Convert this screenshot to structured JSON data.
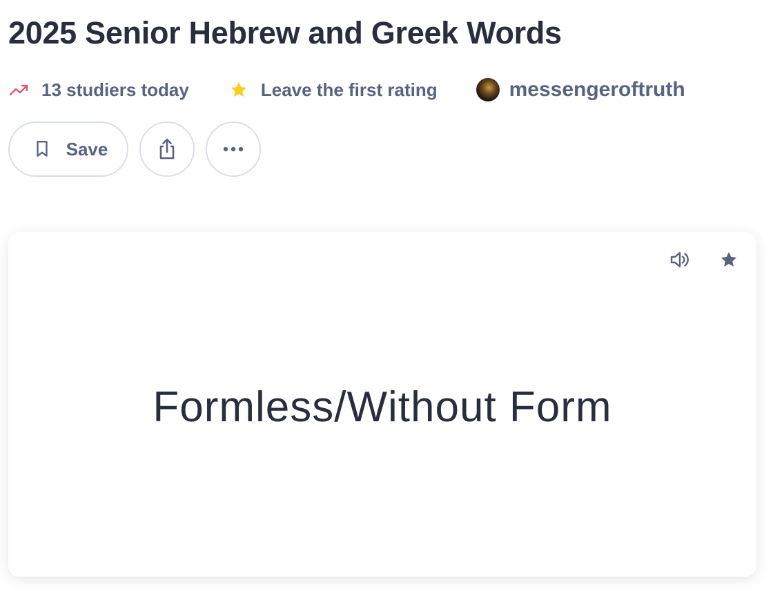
{
  "set": {
    "title": "2025 Senior Hebrew and Greek Words"
  },
  "meta": {
    "studiers": "13 studiers today",
    "studiers_icon": "trending-up-icon",
    "rating": "Leave the first rating",
    "rating_icon": "star-icon",
    "author": "messengeroftruth"
  },
  "actions": {
    "save_label": "Save",
    "save_icon": "bookmark-icon",
    "share_icon": "share-icon",
    "more_icon": "more-horizontal-icon"
  },
  "card": {
    "term": "Formless/Without Form",
    "audio_icon": "speaker-icon",
    "star_icon": "star-icon"
  },
  "colors": {
    "text_primary": "#282e3e",
    "text_secondary": "#586380",
    "trend_accent": "#e0566b",
    "star_accent": "#ffcd1f",
    "border": "#d9dde8"
  }
}
